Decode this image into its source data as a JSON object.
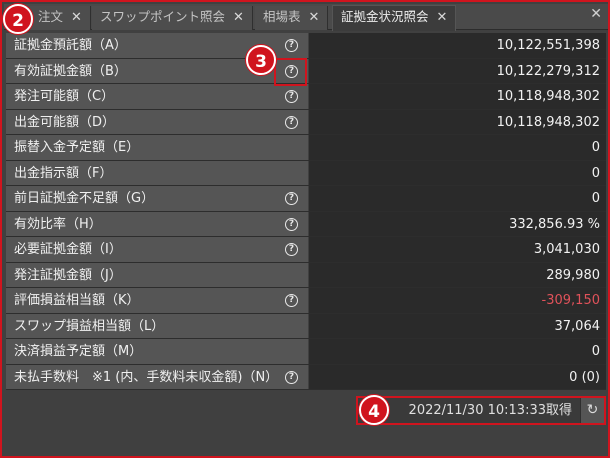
{
  "tabs": [
    {
      "label": "注文",
      "close": "✕"
    },
    {
      "label": "スワップポイント照会",
      "close": "✕"
    },
    {
      "label": "相場表",
      "close": "✕"
    },
    {
      "label": "証拠金状況照会",
      "close": "✕"
    }
  ],
  "window_close": "✕",
  "badges": {
    "b2": "2",
    "b3": "3",
    "b4": "4"
  },
  "rows": [
    {
      "label": "証拠金預託額（A）",
      "value": "10,122,551,398",
      "help": "?"
    },
    {
      "label": "有効証拠金額（B）",
      "value": "10,122,279,312",
      "help": "?"
    },
    {
      "label": "発注可能額（C）",
      "value": "10,118,948,302",
      "help": "?"
    },
    {
      "label": "出金可能額（D）",
      "value": "10,118,948,302",
      "help": "?"
    },
    {
      "label": "振替入金予定額（E）",
      "value": "0"
    },
    {
      "label": "出金指示額（F）",
      "value": "0"
    },
    {
      "label": "前日証拠金不足額（G）",
      "value": "0",
      "help": "?"
    },
    {
      "label": "有効比率（H）",
      "value": "332,856.93 %",
      "help": "?"
    },
    {
      "label": "必要証拠金額（I）",
      "value": "3,041,030",
      "help": "?"
    },
    {
      "label": "発注証拠金額（J）",
      "value": "289,980"
    },
    {
      "label": "評価損益相当額（K）",
      "value": "-309,150",
      "help": "?"
    },
    {
      "label": "スワップ損益相当額（L）",
      "value": "37,064"
    },
    {
      "label": "決済損益予定額（M）",
      "value": "0"
    },
    {
      "label": "未払手数料　※1 (内、手数料未収金額)（N）",
      "value": "0 (0)",
      "help": "?"
    }
  ],
  "footer": {
    "timestamp": "2022/11/30 10:13:33取得",
    "refresh_icon": "↻"
  },
  "colors": {
    "highlight": "#d0141e",
    "negative": "#e0525a"
  }
}
